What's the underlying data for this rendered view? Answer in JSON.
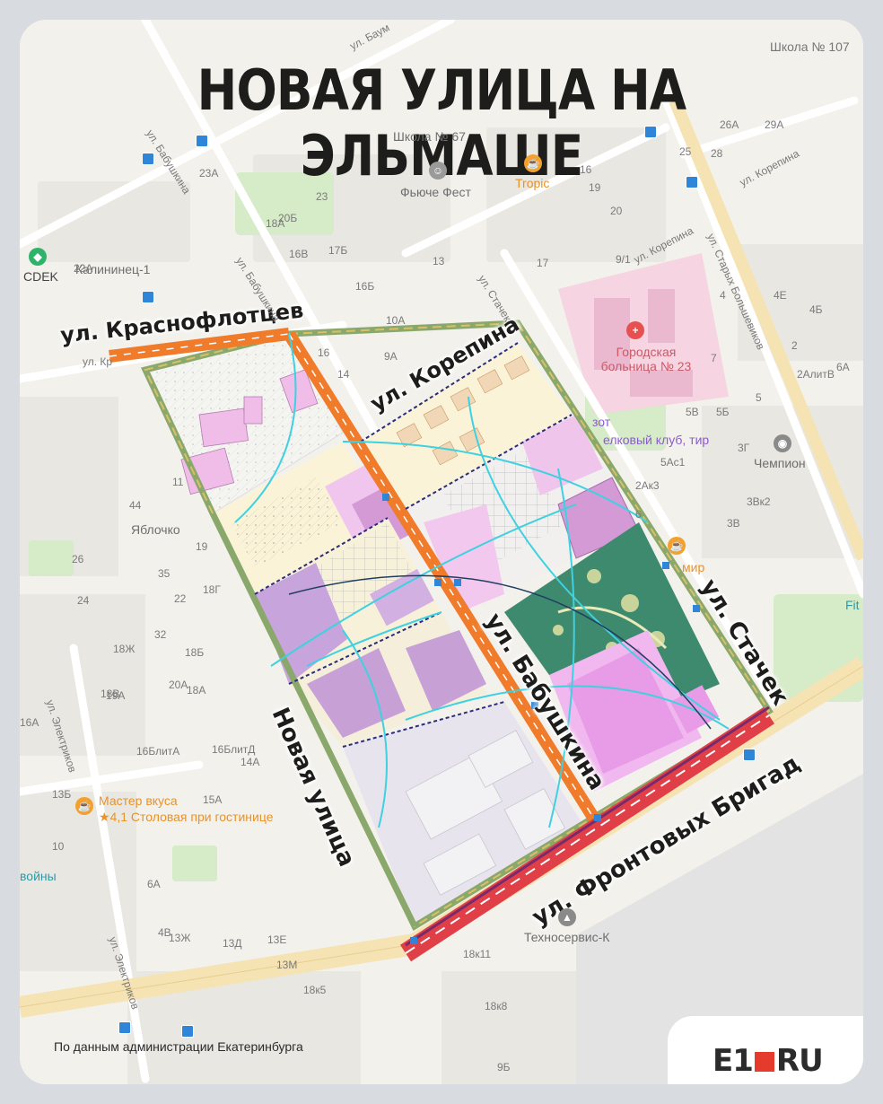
{
  "title": "НОВАЯ УЛИЦА НА ЭЛЬМАШЕ",
  "streets": {
    "krasnoflottsev": "ул. Краснофлотцев",
    "korepina": "ул. Корепина",
    "babushkina": "ул. Бабушкина",
    "stachek": "ул. Стачек",
    "novaya": "Новая улица",
    "frontovyh": "ул. Фронтовых Бригад"
  },
  "map_labels": {
    "school107": "Школа № 107",
    "school67": "Школа № 67",
    "tropic": "Tropic",
    "fyuche": "Фьюче Фест",
    "cdek": "CDEK",
    "kalininets": "Калининец-1",
    "hospital": "Городская больница № 23",
    "chempion": "Чемпион",
    "yablochko": "Яблочко",
    "shooting": "елковый клуб, тир",
    "master": "Мастер вкуса",
    "master_sub": "★4,1 Столовая при гостинице",
    "technoservis": "Техносервис-К",
    "mir": "мир",
    "voiny": "войны",
    "fit": "Fit",
    "zot": "зот",
    "ul_baumana": "ул. Баум",
    "ul_babushkina_small": "ул. Бабушкина",
    "ul_stachek_small": "ул. Стачек",
    "ul_korepina_small": "ул. Корепина",
    "ul_korepina_small2": "ул. Корепина",
    "ul_starykh": "ул. Старых Большевиков",
    "ul_elektrikov": "ул. Электриков",
    "ul_elektrikov2": "ул. Электриков",
    "ul_kr_small": "ул. Кр",
    "ul_babushkina_top": "ул. Бабушкина",
    "numbers": [
      "26А",
      "29А",
      "25",
      "28",
      "4",
      "4Е",
      "4Б",
      "2",
      "2АлитВ",
      "7",
      "5",
      "5В",
      "5Б",
      "3Г",
      "3Вк2",
      "3В",
      "6",
      "10А",
      "9А",
      "16",
      "14",
      "16Б",
      "13",
      "17",
      "16",
      "19",
      "20",
      "23А",
      "22А",
      "20Б",
      "18А",
      "23",
      "17Б",
      "16В",
      "11",
      "44",
      "19",
      "35",
      "22",
      "26",
      "24",
      "32",
      "18Б",
      "18Г",
      "18Ж",
      "18В",
      "20А",
      "18А",
      "19А",
      "16А",
      "16БлитА",
      "16БлитД",
      "14А",
      "15А",
      "13Б",
      "10",
      "6А",
      "13Ж",
      "13Д",
      "13Е",
      "13М",
      "18к5",
      "18к11",
      "18к8",
      "9Б",
      "9/1",
      "5Ас1",
      "2Ак3",
      "6А",
      "4В"
    ]
  },
  "footer": "По данным администрации Екатеринбурга",
  "brand": {
    "left": "E1",
    "right": "RU"
  },
  "colors": {
    "map_bg": "#f2f1ec",
    "road": "#ffffff",
    "main_road": "#f6e3b4",
    "hospital_cross": "#e6514f",
    "park": "#3d8a6d",
    "plan_pink": "#f1c6ee",
    "plan_purple": "#c598d9",
    "new_street": "#f07b2a",
    "red_road": "#e13f47",
    "boundary": "#8aa86b",
    "transit": "#2f86d8",
    "accent": "#e53b2c"
  }
}
